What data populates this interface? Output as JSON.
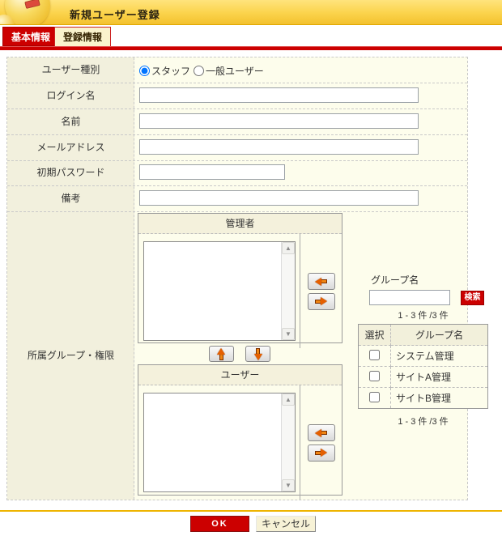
{
  "header": {
    "title": "新規ユーザー登録"
  },
  "tabs": [
    {
      "label": "基本情報",
      "active": true
    },
    {
      "label": "登録情報",
      "active": false
    }
  ],
  "form": {
    "labels": [
      "ユーザー種別",
      "ログイン名",
      "名前",
      "メールアドレス",
      "初期パスワード",
      "備考",
      "所属グループ・権限"
    ],
    "user_type": {
      "options": [
        {
          "label": "スタッフ",
          "selected": true
        },
        {
          "label": "一般ユーザー",
          "selected": false
        }
      ]
    },
    "fields": {
      "login": "",
      "name": "",
      "email": "",
      "password": "",
      "note": ""
    }
  },
  "groups": {
    "admin_title": "管理者",
    "user_title": "ユーザー",
    "search_label": "グループ名",
    "search_value": "",
    "search_button": "検索",
    "count_top": "1 - 3 件 /3 件",
    "count_bottom": "1 - 3 件 /3 件",
    "table": {
      "headers": [
        "選択",
        "グループ名"
      ],
      "rows": [
        {
          "name": "システム管理",
          "checked": false
        },
        {
          "name": "サイトA管理",
          "checked": false
        },
        {
          "name": "サイトB管理",
          "checked": false
        }
      ]
    }
  },
  "footer": {
    "ok": "OK",
    "cancel": "キャンセル"
  },
  "colors": {
    "accent_red": "#cc0000",
    "header_yellow": "#fbd34b",
    "gold_line": "#eeb400"
  }
}
